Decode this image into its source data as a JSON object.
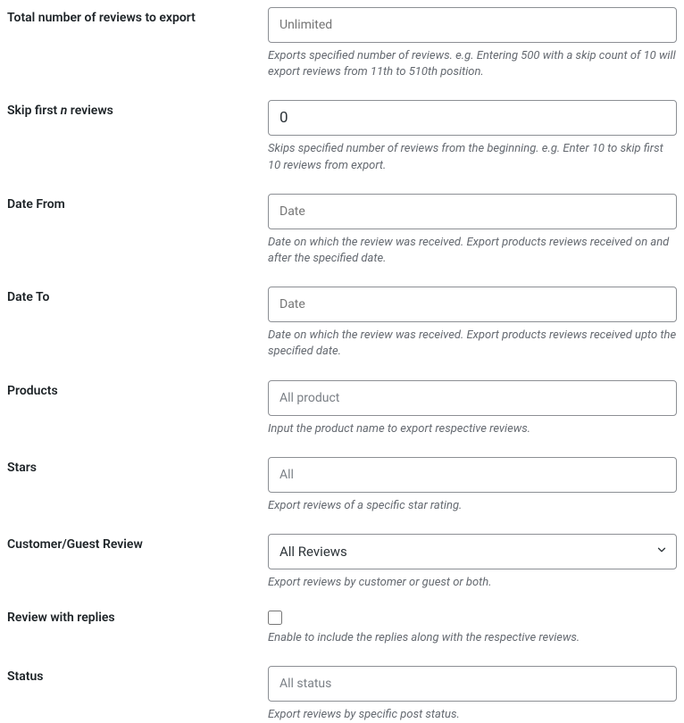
{
  "fields": {
    "total": {
      "label": "Total number of reviews to export",
      "placeholder": "Unlimited",
      "help": "Exports specified number of reviews. e.g. Entering 500 with a skip count of 10 will export reviews from 11th to 510th position."
    },
    "skip": {
      "label_pre": "Skip first ",
      "label_em": "n",
      "label_post": " reviews",
      "value": "0",
      "help": "Skips specified number of reviews from the beginning. e.g. Enter 10 to skip first 10 reviews from export."
    },
    "date_from": {
      "label": "Date From",
      "placeholder": "Date",
      "help": "Date on which the review was received. Export products reviews received on and after the specified date."
    },
    "date_to": {
      "label": "Date To",
      "placeholder": "Date",
      "help": "Date on which the review was received. Export products reviews received upto the specified date."
    },
    "products": {
      "label": "Products",
      "placeholder": "All product",
      "help": "Input the product name to export respective reviews."
    },
    "stars": {
      "label": "Stars",
      "placeholder": "All",
      "help": "Export reviews of a specific star rating."
    },
    "customer_guest": {
      "label": "Customer/Guest Review",
      "selected": "All Reviews",
      "help": "Export reviews by customer or guest or both."
    },
    "replies": {
      "label": "Review with replies",
      "checked": false,
      "help": "Enable to include the replies along with the respective reviews."
    },
    "status": {
      "label": "Status",
      "placeholder": "All status",
      "help": "Export reviews by specific post status."
    }
  }
}
